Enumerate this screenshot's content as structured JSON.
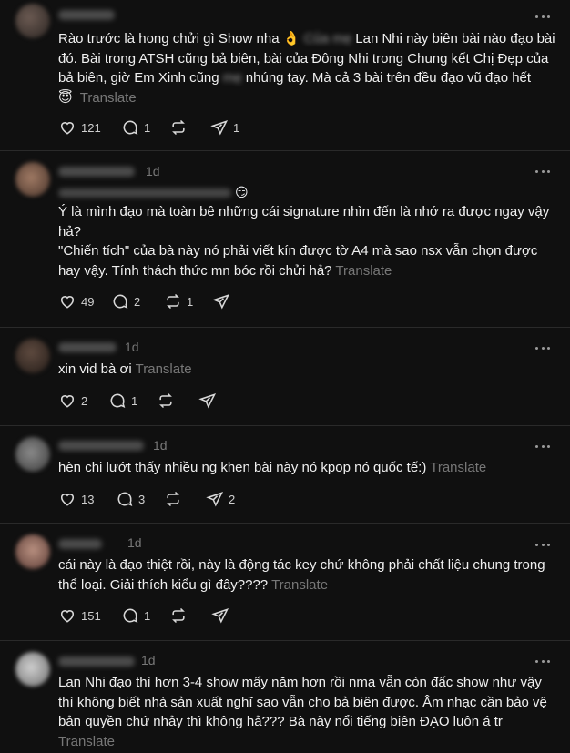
{
  "colors": {
    "background": "#101010",
    "text": "#f3f5f7",
    "muted": "#777777",
    "separator": "#2a2a2a"
  },
  "translate_label": "Translate",
  "posts": [
    {
      "time": "",
      "text_pre": "Rào trước là hong chửi gì Show nha ",
      "emoji_1": "👌",
      "text_mid_blurred": " Của mẹ ",
      "text_rest": "Lan Nhi này biên bài nào đạo bài đó. Bài trong ATSH cũng bả biên, bài của Đông Nhi trong Chung kết Chị Đẹp của bả biên, giờ Em Xinh cũng ",
      "text_blur2": "mẹ",
      "text_end": " nhúng tay. Mà cả 3 bài trên đều đạo vũ đạo hết",
      "emoji_2": "😇",
      "likes": "121",
      "replies": "1",
      "reposts": "",
      "shares": "1"
    },
    {
      "time": "1d",
      "text_line1": "Ý là mình đạo mà toàn bê những cái signature nhìn đến là nhớ ra được ngay vậy hả?",
      "text_line2": "\"Chiến tích\" của bà này nó phải viết kín được tờ A4 mà sao nsx vẫn chọn được hay vậy. Tính thách thức mn bóc rồi chửi hả?",
      "likes": "49",
      "replies": "2",
      "reposts": "1",
      "shares": ""
    },
    {
      "time": "1d",
      "text": "xin vid bà ơi",
      "likes": "2",
      "replies": "1",
      "reposts": "",
      "shares": ""
    },
    {
      "time": "1d",
      "text": "hèn chi lướt thấy nhiều ng khen bài này nó kpop nó quốc tế:)",
      "likes": "13",
      "replies": "3",
      "reposts": "",
      "shares": "2"
    },
    {
      "time": "1d",
      "text": "cái này là đạo thiệt rồi, này là động tác key chứ không phải chất liệu chung trong thể loại. Giải thích kiểu gì đây????",
      "likes": "151",
      "replies": "1",
      "reposts": "",
      "shares": ""
    },
    {
      "time": "1d",
      "text": "Lan Nhi đạo thì hơn 3-4 show mấy năm hơn rồi nma vẫn còn đấc show như vậy thì không biết nhà sản xuất nghĩ sao vẫn cho bả biên được. Âm nhạc cần bảo vệ bản quyền chứ nhảy thì không hả??? Bà này nổi tiếng biên ĐẠO luôn á tr"
    }
  ]
}
